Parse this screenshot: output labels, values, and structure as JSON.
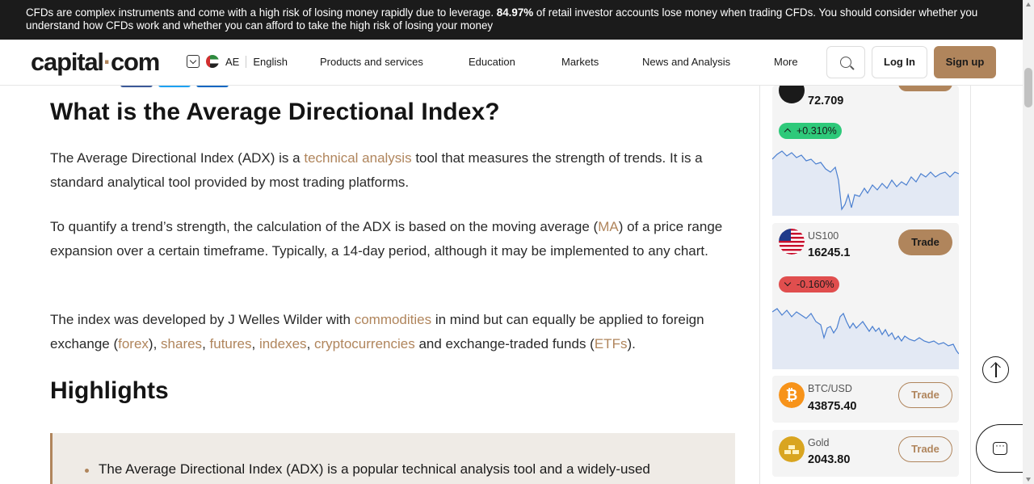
{
  "risk_banner": {
    "text_before": "CFDs are complex instruments and come with a high risk of losing money rapidly due to leverage. ",
    "percent": "84.97%",
    "text_after": " of retail investor accounts lose money when trading CFDs. You should consider whether you understand how CFDs work and whether you can afford to take the high risk of losing your money"
  },
  "header": {
    "logo_left": "capital",
    "logo_dot": "·",
    "logo_right": "com",
    "region": "AE",
    "language": "English",
    "nav": [
      "Products and services",
      "Education",
      "Markets",
      "News and Analysis",
      "More"
    ],
    "login": "Log In",
    "signup": "Sign up"
  },
  "article": {
    "title": "What is the Average Directional Index?",
    "p1": {
      "a": "The Average Directional Index (ADX) is a ",
      "link1": "technical analysis",
      "b": " tool that measures the strength of trends. It is a standard analytical tool provided by most trading platforms."
    },
    "p2": {
      "a": "To quantify a trend’s strength, the calculation of the ADX is based on the moving average (",
      "link1": "MA",
      "b": ") of a price range expansion over a certain timeframe. Typically,  a 14-day period, although it may be implemented to any chart."
    },
    "p3": {
      "a": "The index was developed by J Welles Wilder with ",
      "l_commodities": "commodities",
      "b": " in mind but can equally be applied to foreign exchange (",
      "l_forex": "forex",
      "c": "), ",
      "l_shares": "shares",
      "sep1": ", ",
      "l_futures": "futures",
      "sep2": ", ",
      "l_indexes": "indexes",
      "sep3": ", ",
      "l_crypto": "cryptocurrencies",
      "d": " and exchange-traded funds (",
      "l_etfs": "ETFs",
      "e": ")."
    },
    "highlights_title": "Highlights",
    "highlight_1": "The Average Directional Index (ADX) is a popular technical analysis tool and a widely-used"
  },
  "markets": [
    {
      "price": "72.709",
      "change": "+0.310%",
      "direction": "up"
    },
    {
      "symbol": "US100",
      "price": "16245.1",
      "change": "-0.160%",
      "direction": "down",
      "trade": "Trade"
    },
    {
      "symbol": "BTC/USD",
      "price": "43875.40",
      "trade": "Trade"
    },
    {
      "symbol": "Gold",
      "price": "2043.80",
      "trade": "Trade"
    }
  ],
  "icons": {
    "search": "search-icon",
    "chevron": "chevron-down-icon",
    "scroll_top": "arrow-up-icon",
    "chat": "chat-icon",
    "btc": "bitcoin-icon",
    "gold": "gold-bars-icon",
    "us_flag": "us-flag-icon",
    "ae_flag": "uae-flag-icon"
  },
  "colors": {
    "accent": "#b0855c",
    "banner_bg": "#1b1b1b",
    "up": "#2ec97a",
    "down": "#e04e4e",
    "card_bg": "#f4f4f4",
    "spark_line": "#4a7fd0"
  }
}
